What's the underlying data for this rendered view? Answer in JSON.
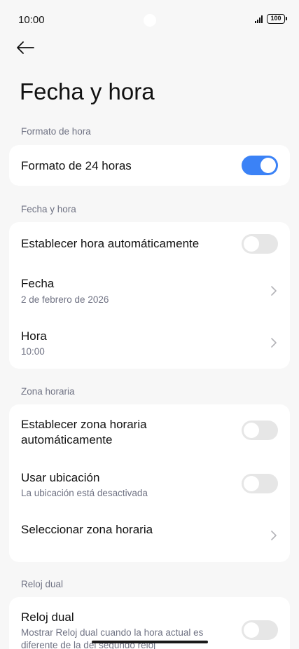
{
  "status": {
    "time": "10:00",
    "battery": "100"
  },
  "page": {
    "title": "Fecha y hora"
  },
  "sections": {
    "time_format": {
      "label": "Formato de hora",
      "format_24h": {
        "title": "Formato de 24 horas",
        "enabled": true
      }
    },
    "date_time": {
      "label": "Fecha y hora",
      "auto_time": {
        "title": "Establecer hora automáticamente",
        "enabled": false
      },
      "date": {
        "title": "Fecha",
        "value": "2 de febrero de 2026"
      },
      "time": {
        "title": "Hora",
        "value": "10:00"
      }
    },
    "timezone": {
      "label": "Zona horaria",
      "auto_timezone": {
        "title_line1": "Establecer zona horaria",
        "title_line2": "automáticamente",
        "enabled": false
      },
      "use_location": {
        "title": "Usar ubicación",
        "subtitle": "La ubicación está desactivada",
        "enabled": false
      },
      "select_timezone": {
        "title": "Seleccionar zona horaria"
      }
    },
    "dual_clock": {
      "label": "Reloj dual",
      "dual_clock": {
        "title": "Reloj dual",
        "subtitle_line1": "Mostrar Reloj dual cuando la hora actual es",
        "subtitle_line2": "diferente de la del segundo reloj",
        "enabled": false
      }
    }
  },
  "colors": {
    "accent": "#3b82f6",
    "toggle_off": "#e6e6e6",
    "secondary_text": "#6f7283"
  },
  "icons": {
    "back": "back-arrow-icon",
    "chevron": "chevron-right-icon"
  }
}
